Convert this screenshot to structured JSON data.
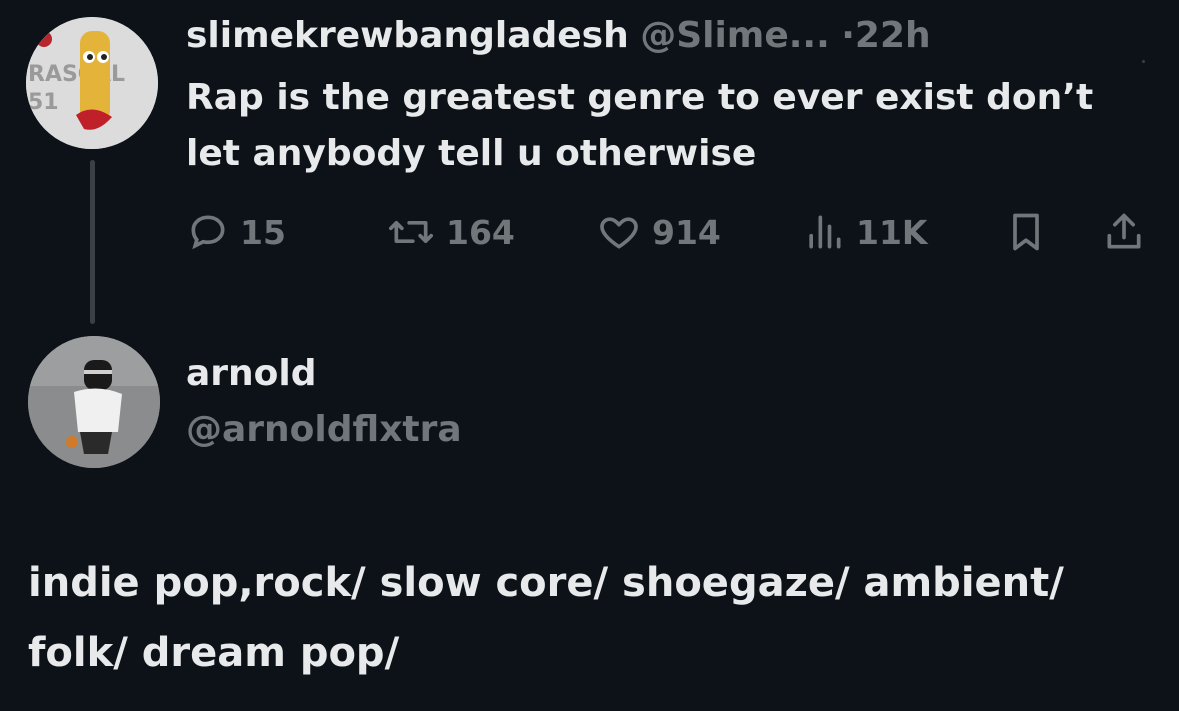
{
  "tweet": {
    "display_name": "slimekrewbangladesh",
    "handle": "@Slime...",
    "separator": "·",
    "time": "22h",
    "text": "Rap is the greatest genre to ever exist don’t let anybody tell u otherwise",
    "avatar_text_top": "RASCAL",
    "avatar_text_bottom": "51",
    "actions": {
      "replies": "15",
      "reposts": "164",
      "likes": "914",
      "views": "11K"
    },
    "icons": [
      "reply-icon",
      "repost-icon",
      "like-icon",
      "views-icon",
      "bookmark-icon",
      "share-icon"
    ]
  },
  "reply_profile": {
    "display_name": "arnold",
    "handle": "@arnoldflxtra",
    "text": "indie pop,rock/ slow core/ shoegaze/ ambient/ folk/ dream pop/"
  },
  "colors": {
    "background": "#0d1219",
    "text_primary": "#e7e9ea",
    "text_muted": "#71767b",
    "thread_line": "#3b4046"
  }
}
